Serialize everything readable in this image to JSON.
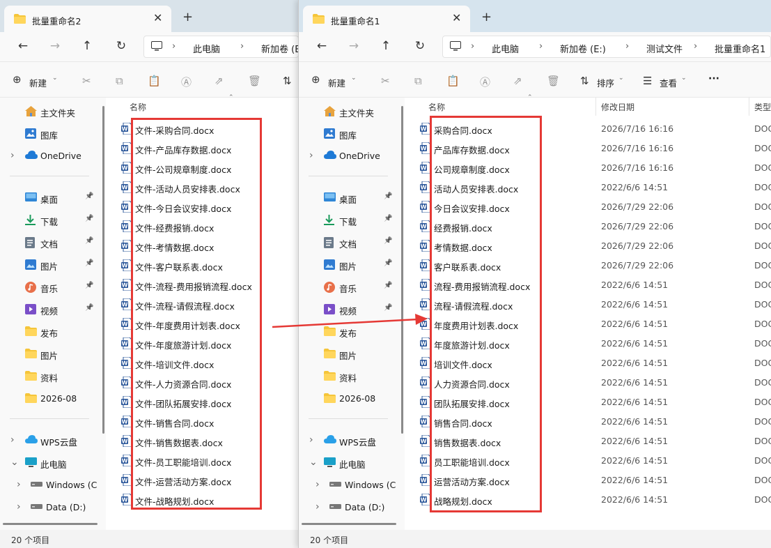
{
  "colors": {
    "accent": "#e53935",
    "word": "#2b579a",
    "folder": "#f5c53a"
  },
  "windows": [
    {
      "id": "w2",
      "tab_title": "批量重命名2",
      "address": [
        "此电脑",
        "新加卷 (E:)"
      ],
      "new_label": "新建",
      "columns": {
        "name": "名称"
      },
      "files": [
        "文件-采购合同.docx",
        "文件-产品库存数据.docx",
        "文件-公司规章制度.docx",
        "文件-活动人员安排表.docx",
        "文件-今日会议安排.docx",
        "文件-经费报销.docx",
        "文件-考情数据.docx",
        "文件-客户联系表.docx",
        "文件-流程-费用报销流程.docx",
        "文件-流程-请假流程.docx",
        "文件-年度费用计划表.docx",
        "文件-年度旅游计划.docx",
        "文件-培训文件.docx",
        "文件-人力资源合同.docx",
        "文件-团队拓展安排.docx",
        "文件-销售合同.docx",
        "文件-销售数据表.docx",
        "文件-员工职能培训.docx",
        "文件-运营活动方案.docx",
        "文件-战略规划.docx"
      ],
      "status": "20 个项目"
    },
    {
      "id": "w1",
      "tab_title": "批量重命名1",
      "address": [
        "此电脑",
        "新加卷 (E:)",
        "测试文件",
        "批量重命名1"
      ],
      "new_label": "新建",
      "sort_label": "排序",
      "view_label": "查看",
      "more_label": "···",
      "columns": {
        "name": "名称",
        "date": "修改日期",
        "type": "类型"
      },
      "files": [
        {
          "name": "采购合同.docx",
          "date": "2026/7/16 16:16",
          "type": "DOC"
        },
        {
          "name": "产品库存数据.docx",
          "date": "2026/7/16 16:16",
          "type": "DOC"
        },
        {
          "name": "公司规章制度.docx",
          "date": "2026/7/16 16:16",
          "type": "DOC"
        },
        {
          "name": "活动人员安排表.docx",
          "date": "2022/6/6 14:51",
          "type": "DOC"
        },
        {
          "name": "今日会议安排.docx",
          "date": "2026/7/29 22:06",
          "type": "DOC"
        },
        {
          "name": "经费报销.docx",
          "date": "2026/7/29 22:06",
          "type": "DOC"
        },
        {
          "name": "考情数据.docx",
          "date": "2026/7/29 22:06",
          "type": "DOC"
        },
        {
          "name": "客户联系表.docx",
          "date": "2026/7/29 22:06",
          "type": "DOC"
        },
        {
          "name": "流程-费用报销流程.docx",
          "date": "2022/6/6 14:51",
          "type": "DOC"
        },
        {
          "name": "流程-请假流程.docx",
          "date": "2022/6/6 14:51",
          "type": "DOC"
        },
        {
          "name": "年度费用计划表.docx",
          "date": "2022/6/6 14:51",
          "type": "DOC"
        },
        {
          "name": "年度旅游计划.docx",
          "date": "2022/6/6 14:51",
          "type": "DOC"
        },
        {
          "name": "培训文件.docx",
          "date": "2022/6/6 14:51",
          "type": "DOC"
        },
        {
          "name": "人力资源合同.docx",
          "date": "2022/6/6 14:51",
          "type": "DOC"
        },
        {
          "name": "团队拓展安排.docx",
          "date": "2022/6/6 14:51",
          "type": "DOC"
        },
        {
          "name": "销售合同.docx",
          "date": "2022/6/6 14:51",
          "type": "DOC"
        },
        {
          "name": "销售数据表.docx",
          "date": "2022/6/6 14:51",
          "type": "DOC"
        },
        {
          "name": "员工职能培训.docx",
          "date": "2022/6/6 14:51",
          "type": "DOC"
        },
        {
          "name": "运营活动方案.docx",
          "date": "2022/6/6 14:51",
          "type": "DOC"
        },
        {
          "name": "战略规划.docx",
          "date": "2022/6/6 14:51",
          "type": "DOC"
        }
      ],
      "status": "20 个项目"
    }
  ],
  "sidebar": [
    {
      "label": "主文件夹",
      "icon": "home-icon",
      "kind": "home"
    },
    {
      "label": "图库",
      "icon": "gallery-icon",
      "kind": "gallery"
    },
    {
      "label": "OneDrive",
      "icon": "cloud-icon",
      "kind": "cloud",
      "expandable": true
    },
    {
      "sep": true
    },
    {
      "label": "桌面",
      "icon": "desktop-icon",
      "kind": "desktop",
      "pinned": true
    },
    {
      "label": "下载",
      "icon": "download-icon",
      "kind": "download",
      "pinned": true
    },
    {
      "label": "文档",
      "icon": "document-icon",
      "kind": "doc",
      "pinned": true
    },
    {
      "label": "图片",
      "icon": "picture-icon",
      "kind": "picture",
      "pinned": true
    },
    {
      "label": "音乐",
      "icon": "music-icon",
      "kind": "music",
      "pinned": true
    },
    {
      "label": "视频",
      "icon": "video-icon",
      "kind": "video",
      "pinned": true
    },
    {
      "label": "发布",
      "icon": "folder-icon",
      "kind": "folder"
    },
    {
      "label": "图片",
      "icon": "folder-icon",
      "kind": "folder"
    },
    {
      "label": "资料",
      "icon": "folder-icon",
      "kind": "folder"
    },
    {
      "label": "2026-08",
      "icon": "folder-icon",
      "kind": "folder"
    },
    {
      "sep": true
    },
    {
      "label": "WPS云盘",
      "icon": "cloud-icon",
      "kind": "wps",
      "expandable": true
    },
    {
      "label": "此电脑",
      "icon": "computer-icon",
      "kind": "pc",
      "expanded": true
    },
    {
      "label": "Windows (C",
      "icon": "drive-icon",
      "kind": "drive",
      "expandable": true,
      "indent": true
    },
    {
      "label": "Data (D:)",
      "icon": "drive-icon",
      "kind": "drive",
      "expandable": true,
      "indent": true
    }
  ]
}
